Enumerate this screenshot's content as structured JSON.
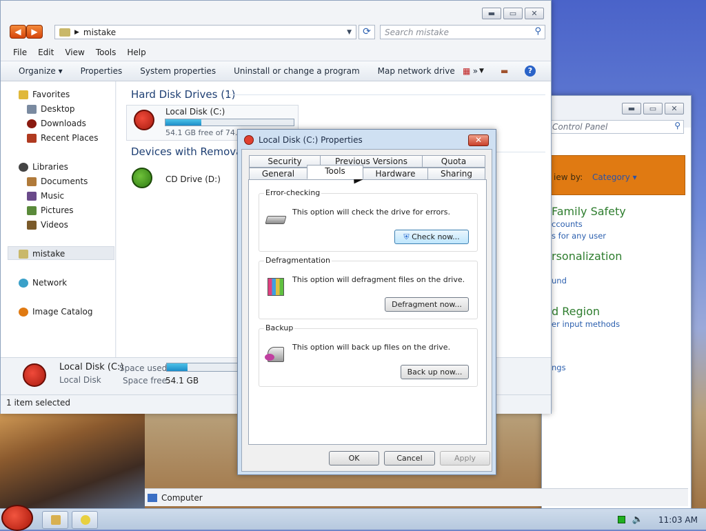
{
  "explorer": {
    "address_path": "mistake",
    "search_placeholder": "Search mistake",
    "menu": [
      "File",
      "Edit",
      "View",
      "Tools",
      "Help"
    ],
    "toolbar": [
      "Organize ▾",
      "Properties",
      "System properties",
      "Uninstall or change a program",
      "Map network drive",
      "»"
    ],
    "nav": {
      "favorites": "Favorites",
      "desktop": "Desktop",
      "downloads": "Downloads",
      "recent": "Recent Places",
      "libraries": "Libraries",
      "documents": "Documents",
      "music": "Music",
      "pictures": "Pictures",
      "videos": "Videos",
      "mistake": "mistake",
      "network": "Network",
      "image_catalog": "Image Catalog"
    },
    "groups": {
      "hdd": "Hard Disk Drives (1)",
      "removable": "Devices with Removable"
    },
    "local_disk": {
      "name": "Local Disk (C:)",
      "free": "54.1 GB free of 74.8",
      "used_fraction": 0.28
    },
    "cd": {
      "name": "CD Drive (D:)"
    },
    "details": {
      "name": "Local Disk (C:)",
      "type": "Local Disk",
      "space_used_label": "Space used:",
      "space_free_label": "Space free:",
      "space_free": "54.1 GB",
      "used_fraction": 0.28
    },
    "status": "1 item selected"
  },
  "control_panel": {
    "search_placeholder": "Control Panel",
    "view_by": "iew by:",
    "category": "Category ▾",
    "links": [
      {
        "title": "Family Safety",
        "sub": "ccounts"
      },
      {
        "title": "",
        "sub": "s for any user"
      },
      {
        "title": "rsonalization",
        "sub": "und"
      },
      {
        "title": "d Region",
        "sub": "er input methods"
      },
      {
        "title": "",
        "sub": "ngs"
      }
    ],
    "status": "Computer"
  },
  "dialog": {
    "title": "Local Disk (C:) Properties",
    "tabs_row1": [
      "Security",
      "Previous Versions",
      "Quota"
    ],
    "tabs_row2": [
      "General",
      "Tools",
      "Hardware",
      "Sharing"
    ],
    "error_checking": {
      "label": "Error-checking",
      "text": "This option will check the drive for errors.",
      "button": "Check now..."
    },
    "defrag": {
      "label": "Defragmentation",
      "text": "This option will defragment files on the drive.",
      "button": "Defragment now..."
    },
    "backup": {
      "label": "Backup",
      "text": "This option will back up files on the drive.",
      "button": "Back up now..."
    },
    "ok": "OK",
    "cancel": "Cancel",
    "apply": "Apply"
  },
  "taskbar": {
    "time": "11:03 AM"
  }
}
